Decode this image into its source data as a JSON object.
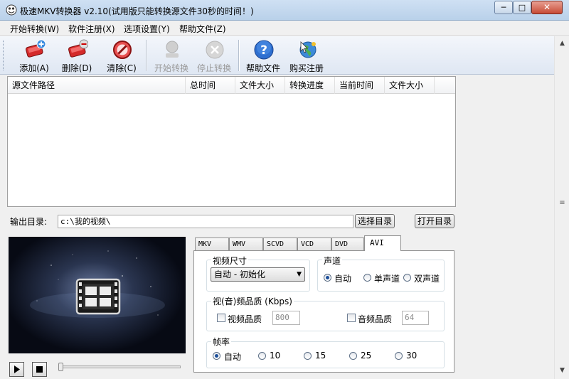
{
  "window": {
    "title": "极速MKV转换器 v2.10(试用版只能转换源文件30秒的时间！)",
    "min_label": "─",
    "max_label": "□",
    "close_label": "✕"
  },
  "menu": [
    "开始转换(W)",
    "软件注册(X)",
    "选项设置(Y)",
    "帮助文件(Z)"
  ],
  "toolbar": [
    {
      "label": "添加(A)",
      "icon": "add-icon",
      "enabled": true
    },
    {
      "label": "删除(D)",
      "icon": "delete-icon",
      "enabled": true
    },
    {
      "label": "清除(C)",
      "icon": "clear-icon",
      "enabled": true
    },
    {
      "label": "开始转换",
      "icon": "start-convert-icon",
      "enabled": false
    },
    {
      "label": "停止转换",
      "icon": "stop-convert-icon",
      "enabled": false
    },
    {
      "label": "帮助文件",
      "icon": "help-icon",
      "enabled": true
    },
    {
      "label": "购买注册",
      "icon": "buy-register-icon",
      "enabled": true
    }
  ],
  "file_table": {
    "columns": [
      "源文件路径",
      "总时间",
      "文件大小",
      "转换进度",
      "当前时间",
      "文件大小"
    ],
    "rows": []
  },
  "output": {
    "label": "输出目录:",
    "path": "c:\\我的视频\\",
    "select_button": "选择目录",
    "open_button": "打开目录"
  },
  "player": {
    "play_icon": "play-icon",
    "stop_icon": "stop-icon",
    "seek_position": 0
  },
  "tabs": [
    "MKV",
    "WMV",
    "SCVD",
    "VCD",
    "DVD",
    "AVI"
  ],
  "active_tab": "AVI",
  "settings": {
    "video_size_label": "视频尺寸",
    "video_size_value": "自动 - 初始化",
    "audio_channel_label": "声道",
    "channels": [
      "自动",
      "单声道",
      "双声道"
    ],
    "channel_selected": "自动",
    "quality_label": "视(音)频品质 (Kbps)",
    "video_quality_label": "视频品质",
    "video_quality_value": "800",
    "audio_quality_label": "音频品质",
    "audio_quality_value": "64",
    "fps_label": "帧率",
    "fps_options": [
      "自动",
      "10",
      "15",
      "25",
      "30"
    ],
    "fps_selected": "自动"
  },
  "colors": {
    "titlebar": "#c4d8ee",
    "toolbar": "#e6edf6",
    "preview_bg": "#070a14",
    "close_button": "#c74a35"
  }
}
